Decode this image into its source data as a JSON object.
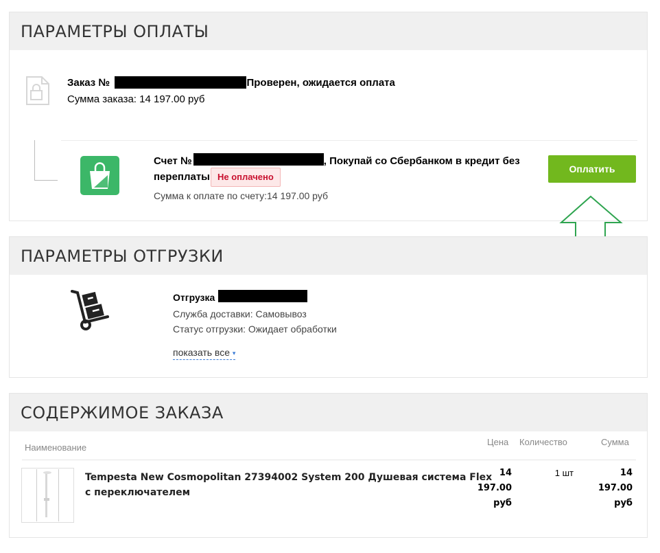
{
  "payment": {
    "title": "ПАРАМЕТРЫ ОПЛАТЫ",
    "order_prefix": "Заказ №",
    "order_status": ", Проверен, ожидается оплата",
    "order_sum": "Сумма заказа: 14 197.00 руб",
    "invoice_prefix": "Счет №",
    "invoice_line1_suffix": ", Покупай со Сбербанком в кредит без",
    "invoice_line2": "переплаты",
    "badge_unpaid": "Не оплачено",
    "invoice_sum": "Сумма к оплате по счету:14 197.00 руб",
    "pay_button": "Оплатить",
    "accent_color": "#72b81e",
    "annotation_arrow_color": "#2ea44f"
  },
  "shipment": {
    "title": "ПАРАМЕТРЫ ОТГРУЗКИ",
    "shipment_label": "Отгрузка",
    "delivery_service": "Служба доставки: Самовывоз",
    "status": "Статус отгрузки: Ожидает обработки",
    "show_all": "показать все",
    "show_all_caret": "▾"
  },
  "contents": {
    "title": "СОДЕРЖИМОЕ ЗАКАЗА",
    "columns": {
      "name": "Наименование",
      "price": "Цена",
      "qty": "Количество",
      "sum": "Сумма"
    },
    "items": [
      {
        "name_line1": "Tempesta New Cosmopolitan 27394002 System 200 Душевая система Flex",
        "name_line2": "с переключателем",
        "price_line1": "14 197.00",
        "price_line2": "руб",
        "qty": "1 шт",
        "sum_line1": "14 197.00",
        "sum_line2": "руб"
      }
    ]
  },
  "icons": {
    "order_doc": "document-lock-icon",
    "sber_pay": "sber-bag-icon",
    "hand_truck": "hand-truck-icon",
    "product_thumb": "shower-system-thumbnail",
    "annotation": "up-arrow-annotation-icon"
  }
}
